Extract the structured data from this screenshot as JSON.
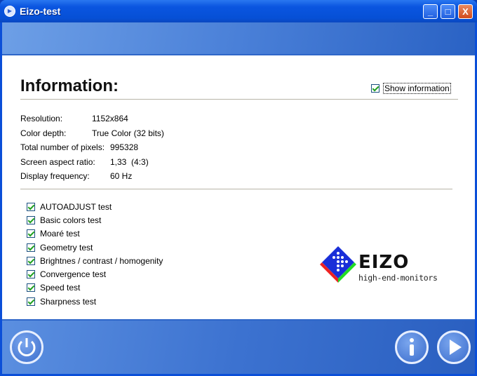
{
  "window": {
    "title": "Eizo-test",
    "minimize": "_",
    "maximize": "□",
    "close": "X"
  },
  "heading": "Information:",
  "show_information": {
    "label": "Show information",
    "checked": true
  },
  "info": [
    {
      "label": "Resolution:",
      "value": "1152x864"
    },
    {
      "label": "Color depth:",
      "value": "True Color (32 bits)"
    },
    {
      "label": "Total number of pixels:",
      "value": "995328"
    },
    {
      "label": "Screen aspect ratio:",
      "value": "1,33  (4:3)"
    },
    {
      "label": "Display frequency:",
      "value": "60 Hz"
    }
  ],
  "tests": [
    {
      "label": "AUTOADJUST test",
      "checked": true
    },
    {
      "label": "Basic colors test",
      "checked": true
    },
    {
      "label": "Moaré test",
      "checked": true
    },
    {
      "label": "Geometry test",
      "checked": true
    },
    {
      "label": "Brightnes / contrast / homogenity",
      "checked": true
    },
    {
      "label": "Convergence test",
      "checked": true
    },
    {
      "label": "Speed test",
      "checked": true
    },
    {
      "label": "Sharpness test",
      "checked": true
    }
  ],
  "logo": {
    "brand": "EIZO",
    "tagline": "high-end-monitors"
  }
}
